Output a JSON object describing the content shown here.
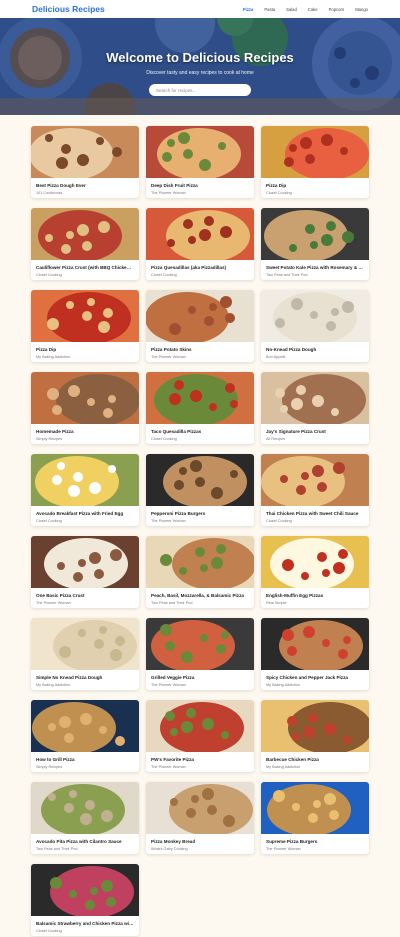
{
  "header": {
    "brand": "Delicious Recipes",
    "nav": [
      "Pizza",
      "Pasta",
      "Salad",
      "Cake",
      "Popcorn",
      "Mango"
    ],
    "active_nav": "Pizza"
  },
  "hero": {
    "title": "Welcome to Delicious Recipes",
    "subtitle": "Discover tasty and easy recipes to cook at home",
    "search_placeholder": "Search for recipes..."
  },
  "recipes": [
    {
      "title": "Best Pizza Dough Ever",
      "source": "101 Cookbooks",
      "image": "pizza-dough-icon"
    },
    {
      "title": "Deep Dish Fruit Pizza",
      "source": "The Pioneer Woman",
      "image": "fruit-pizza-icon"
    },
    {
      "title": "Pizza Dip",
      "source": "Closet Cooking",
      "image": "pizza-dip-icon"
    },
    {
      "title": "Cauliflower Pizza Crust (with BBQ Chicken Pizza)",
      "source": "Closet Cooking",
      "image": "pizza-slices-icon"
    },
    {
      "title": "Pizza Quesadillas (aka Pizzadillas)",
      "source": "Closet Cooking",
      "image": "quesadilla-icon"
    },
    {
      "title": "Sweet Potato Kale Pizza with Rosemary & Red Onion",
      "source": "Two Peas and Their Pod",
      "image": "kale-pizza-icon"
    },
    {
      "title": "Pizza Dip",
      "source": "My Baking Addiction",
      "image": "pizza-dip-icon"
    },
    {
      "title": "Pizza Potato Skins",
      "source": "The Pioneer Woman",
      "image": "potato-skins-icon"
    },
    {
      "title": "No-Knead Pizza Dough",
      "source": "Bon Appetit",
      "image": "dough-ball-icon"
    },
    {
      "title": "Homemade Pizza",
      "source": "Simply Recipes",
      "image": "homemade-pizza-icon"
    },
    {
      "title": "Taco Quesadilla Pizzas",
      "source": "Closet Cooking",
      "image": "taco-pizza-icon"
    },
    {
      "title": "Jay's Signature Pizza Crust",
      "source": "All Recipes",
      "image": "pizza-crust-icon"
    },
    {
      "title": "Avocado Breakfast Pizza with Fried Egg",
      "source": "Closet Cooking",
      "image": "egg-pizza-icon"
    },
    {
      "title": "Pepperoni Pizza Burgers",
      "source": "The Pioneer Woman",
      "image": "burger-icon"
    },
    {
      "title": "Thai Chicken Pizza with Sweet Chili Sauce",
      "source": "Closet Cooking",
      "image": "thai-pizza-icon"
    },
    {
      "title": "One Basic Pizza Crust",
      "source": "The Pioneer Woman",
      "image": "basic-crust-icon"
    },
    {
      "title": "Peach, Basil, Mozzarella, & Balsamic Pizza",
      "source": "Two Peas and Their Pod",
      "image": "peach-pizza-icon"
    },
    {
      "title": "English-Muffin Egg Pizzas",
      "source": "Real Simple",
      "image": "muffin-pizza-icon"
    },
    {
      "title": "Simple No Knead Pizza Dough",
      "source": "My Baking Addiction",
      "image": "dough-balls-icon"
    },
    {
      "title": "Grilled Veggie Pizza",
      "source": "The Pioneer Woman",
      "image": "veggie-pizza-icon"
    },
    {
      "title": "Spicy Chicken and Pepper Jack Pizza",
      "source": "My Baking Addiction",
      "image": "spicy-pizza-icon"
    },
    {
      "title": "How to Grill Pizza",
      "source": "Simply Recipes",
      "image": "grill-pizza-icon"
    },
    {
      "title": "PW's Favorite Pizza",
      "source": "The Pioneer Woman",
      "image": "favorite-pizza-icon"
    },
    {
      "title": "Barbecue Chicken Pizza",
      "source": "My Baking Addiction",
      "image": "bbq-pizza-icon"
    },
    {
      "title": "Avocado Pita Pizza with Cilantro Sauce",
      "source": "Two Peas and Their Pod",
      "image": "pita-pizza-icon"
    },
    {
      "title": "Pizza Monkey Bread",
      "source": "What's Gaby Cooking",
      "image": "monkey-bread-icon"
    },
    {
      "title": "Supreme Pizza Burgers",
      "source": "The Pioneer Woman",
      "image": "supreme-burger-icon"
    },
    {
      "title": "Balsamic Strawberry and Chicken Pizza with Sweet Onions and Smoky Bacon",
      "source": "Closet Cooking",
      "image": "strawberry-pizza-icon"
    }
  ],
  "colors": {
    "brand": "#2f6fd6",
    "page_bg": "#fdf8f0"
  }
}
